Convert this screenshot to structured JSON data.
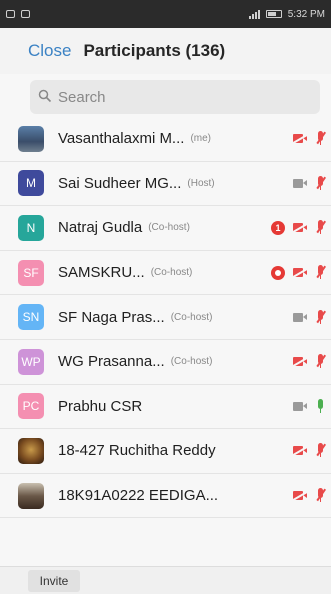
{
  "status_bar": {
    "time": "5:32 PM"
  },
  "header": {
    "close_label": "Close",
    "title": "Participants (136)"
  },
  "search": {
    "placeholder": "Search"
  },
  "participants": [
    {
      "name": "Vasanthalaxmi M...",
      "role": "(me)",
      "avatar_type": "photo1",
      "avatar_text": "",
      "avatar_color": "",
      "badge": "",
      "video": "off",
      "audio": "muted"
    },
    {
      "name": "Sai Sudheer MG...",
      "role": "(Host)",
      "avatar_type": "letter",
      "avatar_text": "M",
      "avatar_color": "#3f4a9c",
      "badge": "",
      "video": "grey",
      "audio": "muted"
    },
    {
      "name": "Natraj Gudla",
      "role": "(Co-host)",
      "avatar_type": "letter",
      "avatar_text": "N",
      "avatar_color": "#26a69a",
      "badge": "1",
      "video": "off",
      "audio": "muted"
    },
    {
      "name": "SAMSKRU...",
      "role": "(Co-host)",
      "avatar_type": "letter",
      "avatar_text": "SF",
      "avatar_color": "#f48fb1",
      "badge": "rec",
      "video": "off",
      "audio": "muted"
    },
    {
      "name": "SF Naga Pras...",
      "role": "(Co-host)",
      "avatar_type": "letter",
      "avatar_text": "SN",
      "avatar_color": "#64b5f6",
      "badge": "",
      "video": "grey",
      "audio": "muted"
    },
    {
      "name": "WG Prasanna...",
      "role": "(Co-host)",
      "avatar_type": "letter",
      "avatar_text": "WP",
      "avatar_color": "#ce93d8",
      "badge": "",
      "video": "off",
      "audio": "muted"
    },
    {
      "name": "Prabhu CSR",
      "role": "",
      "avatar_type": "letter",
      "avatar_text": "PC",
      "avatar_color": "#f48fb1",
      "badge": "",
      "video": "grey",
      "audio": "on"
    },
    {
      "name": "18-427 Ruchitha Reddy",
      "role": "",
      "avatar_type": "photo2",
      "avatar_text": "",
      "avatar_color": "",
      "badge": "",
      "video": "off",
      "audio": "muted"
    },
    {
      "name": "18K91A0222 EEDIGA...",
      "role": "",
      "avatar_type": "photo3",
      "avatar_text": "",
      "avatar_color": "",
      "badge": "",
      "video": "off",
      "audio": "muted"
    }
  ],
  "footer": {
    "invite_label": "Invite"
  }
}
